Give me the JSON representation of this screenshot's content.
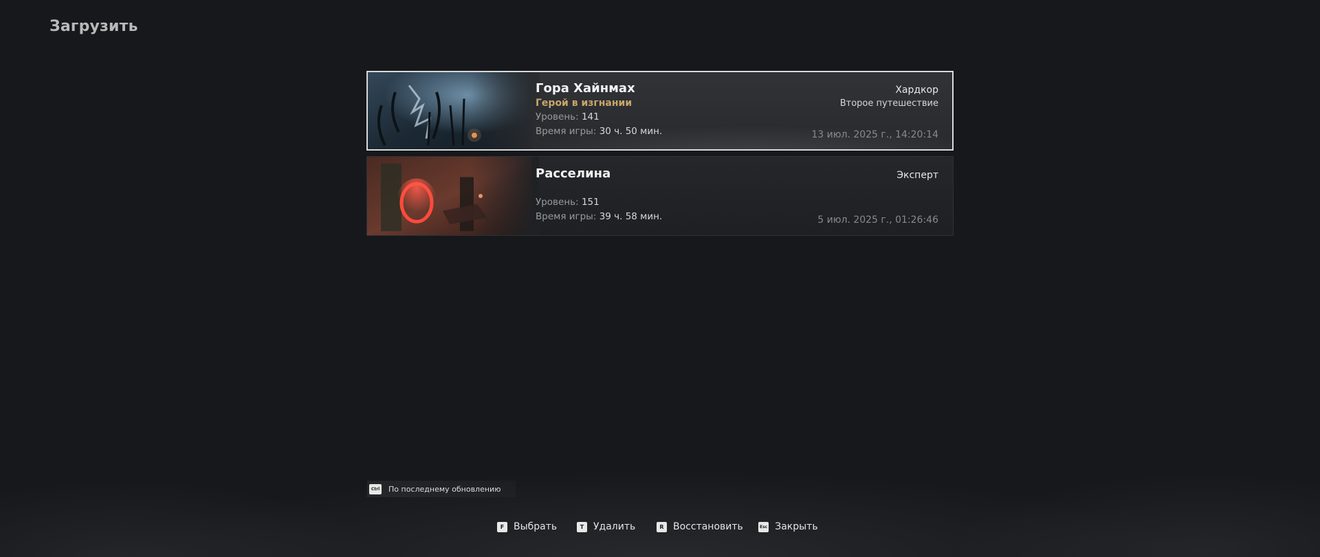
{
  "page": {
    "title": "Загрузить"
  },
  "saves": [
    {
      "name": "Гора Хайнмах",
      "subtitle": "Герой в изгнании",
      "difficulty": "Хардкор",
      "journey": "Второе путешествие",
      "level_label": "Уровень:",
      "level_value": "141",
      "playtime_label": "Время игры:",
      "playtime_value": "30 ч. 50 мин.",
      "date": "13 июл. 2025 г., 14:20:14",
      "selected": true
    },
    {
      "name": "Расселина",
      "subtitle": "",
      "difficulty": "Эксперт",
      "journey": "",
      "level_label": "Уровень:",
      "level_value": "151",
      "playtime_label": "Время игры:",
      "playtime_value": "39 ч. 58 мин.",
      "date": "5 июл. 2025 г., 01:26:46",
      "selected": false
    }
  ],
  "sort": {
    "key": "Ctrl",
    "label": "По последнему обновлению"
  },
  "actions": [
    {
      "key": "F",
      "label": "Выбрать"
    },
    {
      "key": "T",
      "label": "Удалить"
    },
    {
      "key": "R",
      "label": "Восстановить"
    },
    {
      "key": "Esc",
      "label": "Закрыть"
    }
  ],
  "colors": {
    "background": "#16181b",
    "accent_gold": "#c9a66b",
    "selected_border": "#d9d9d9"
  }
}
